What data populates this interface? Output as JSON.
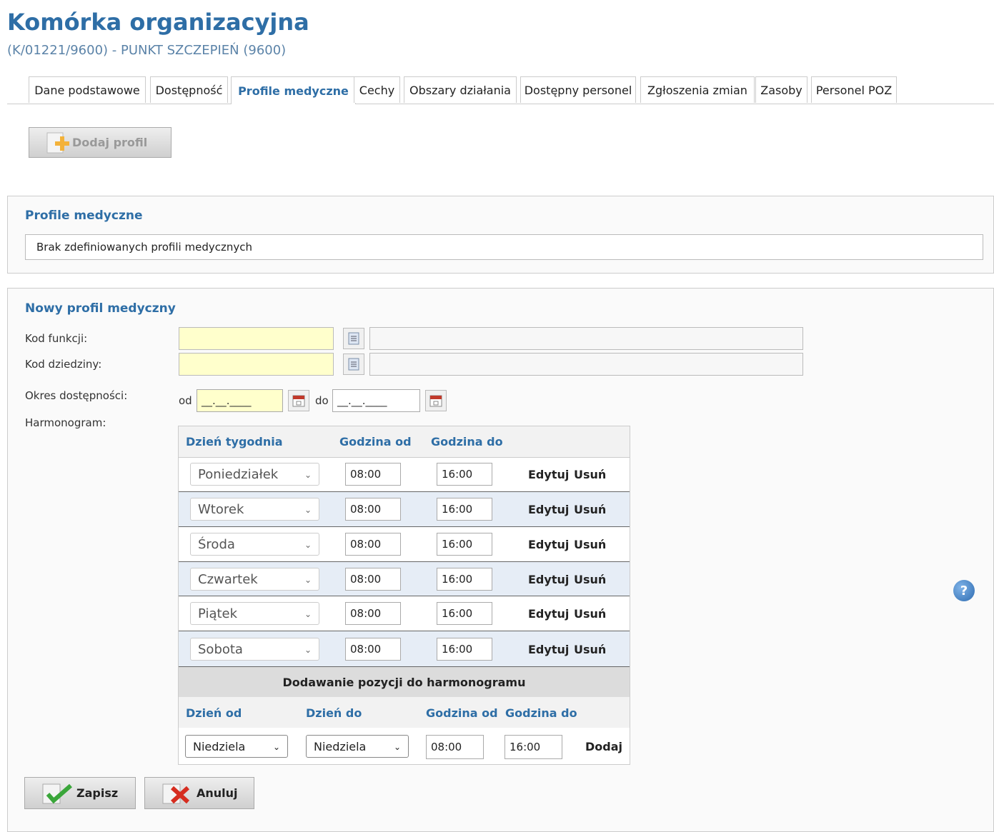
{
  "header": {
    "title": "Komórka organizacyjna",
    "subtitle": "(K/01221/9600) - PUNKT SZCZEPIEŃ (9600)"
  },
  "tabs": [
    {
      "label": "Dane podstawowe"
    },
    {
      "label": "Dostępność"
    },
    {
      "label": "Profile medyczne",
      "active": true
    },
    {
      "label": "Cechy"
    },
    {
      "label": "Obszary działania"
    },
    {
      "label": "Dostępny personel"
    },
    {
      "label": "Zgłoszenia zmian"
    },
    {
      "label": "Zasoby"
    },
    {
      "label": "Personel POZ"
    }
  ],
  "toolbar": {
    "add_profile": "Dodaj profil"
  },
  "profiles": {
    "title": "Profile medyczne",
    "empty_text": "Brak zdefiniowanych profili medycznych"
  },
  "form": {
    "title": "Nowy profil medyczny",
    "kod_funkcji_label": "Kod funkcji:",
    "kod_dziedziny_label": "Kod dziedziny:",
    "okres_label": "Okres dostępności:",
    "od_label": "od",
    "do_label": "do",
    "date_from": "__.__.____",
    "date_to": "__.__.____",
    "harmonogram_label": "Harmonogram:"
  },
  "schedule": {
    "headers": {
      "day": "Dzień tygodnia",
      "from": "Godzina od",
      "to": "Godzina do"
    },
    "edit_label": "Edytuj",
    "delete_label": "Usuń",
    "rows": [
      {
        "day": "Poniedziałek",
        "from": "08:00",
        "to": "16:00"
      },
      {
        "day": "Wtorek",
        "from": "08:00",
        "to": "16:00"
      },
      {
        "day": "Środa",
        "from": "08:00",
        "to": "16:00"
      },
      {
        "day": "Czwartek",
        "from": "08:00",
        "to": "16:00"
      },
      {
        "day": "Piątek",
        "from": "08:00",
        "to": "16:00"
      },
      {
        "day": "Sobota",
        "from": "08:00",
        "to": "16:00"
      }
    ],
    "add_section": {
      "title": "Dodawanie pozycji do harmonogramu",
      "headers": {
        "day_from": "Dzień od",
        "day_to": "Dzień do",
        "hour_from": "Godzina od",
        "hour_to": "Godzina do"
      },
      "day_from": "Niedziela",
      "day_to": "Niedziela",
      "hour_from": "08:00",
      "hour_to": "16:00",
      "add_label": "Dodaj"
    }
  },
  "footer": {
    "save": "Zapisz",
    "cancel": "Anuluj"
  }
}
